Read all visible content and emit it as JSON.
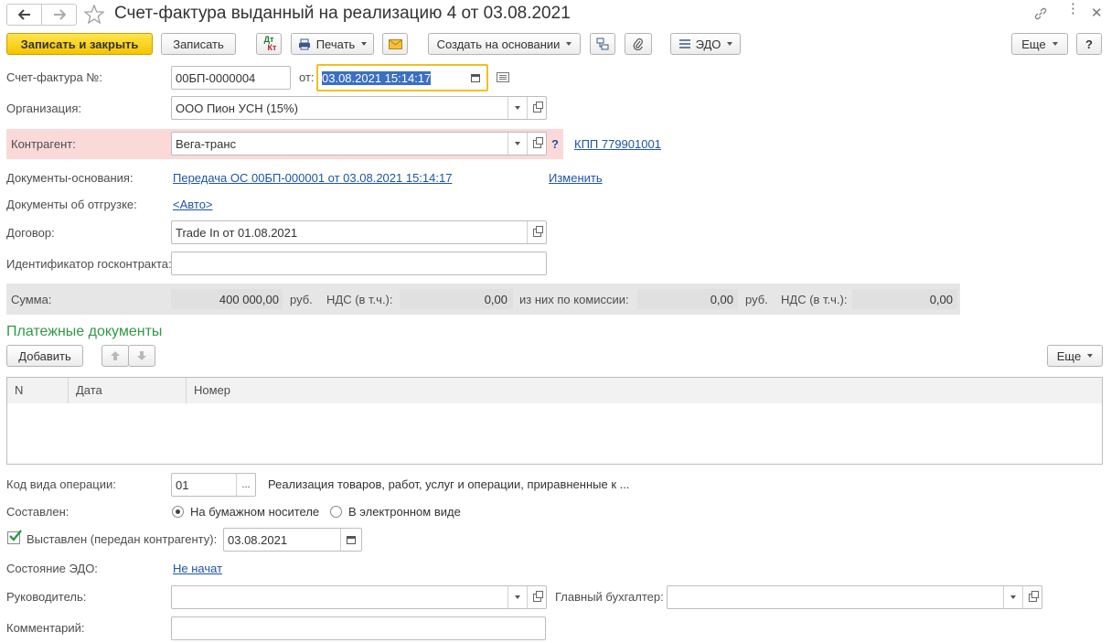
{
  "title": "Счет-фактура выданный на реализацию 4 от 03.08.2021",
  "toolbar": {
    "save_close": "Записать и закрыть",
    "save": "Записать",
    "dtkt_top": "Дт",
    "dtkt_bottom": "Кт",
    "print": "Печать",
    "create_based": "Создать на основании",
    "edo": "ЭДО",
    "more": "Еще",
    "help": "?"
  },
  "form": {
    "invoice_label": "Счет-фактура №:",
    "invoice_number": "00БП-0000004",
    "from_label": "от:",
    "date": "03.08.2021 15:14:17",
    "org_label": "Организация:",
    "org_value": "ООО Пион УСН (15%)",
    "contractor_label": "Контрагент:",
    "contractor_value": "Вега-транс",
    "contractor_q": "?",
    "kpp_link": "КПП 779901001",
    "base_docs_label": "Документы-основания:",
    "base_docs_link": "Передача ОС 00БП-000001 от 03.08.2021 15:14:17",
    "change_link": "Изменить",
    "ship_docs_label": "Документы об отгрузке:",
    "ship_docs_link": "<Авто>",
    "contract_label": "Договор:",
    "contract_value": "Trade In от 01.08.2021",
    "gov_id_label": "Идентификатор госконтракта:",
    "gov_id_value": ""
  },
  "sum": {
    "label": "Сумма:",
    "amount": "400 000,00",
    "cur1": "руб.",
    "vat_label": "НДС (в т.ч.):",
    "vat_amount": "0,00",
    "commission_label": "из них по комиссии:",
    "commission_amount": "0,00",
    "cur2": "руб.",
    "vat_label2": "НДС (в т.ч.):",
    "vat_amount2": "0,00"
  },
  "payments": {
    "title": "Платежные документы",
    "add": "Добавить",
    "more": "Еще",
    "columns": [
      "N",
      "Дата",
      "Номер"
    ]
  },
  "bottom": {
    "op_code_label": "Код вида операции:",
    "op_code": "01",
    "op_code_btn": "...",
    "op_code_desc": "Реализация товаров, работ, услуг и операции, приравненные к ...",
    "composed_label": "Составлен:",
    "paper": "На бумажном носителе",
    "electronic": "В электронном виде",
    "issued_label": "Выставлен (передан контрагенту):",
    "issued_date": "03.08.2021",
    "edo_state_label": "Состояние ЭДО:",
    "edo_state_link": "Не начат",
    "head_label": "Руководитель:",
    "head_value": "",
    "chief_acc_label": "Главный бухгалтер:",
    "chief_acc_value": "",
    "comment_label": "Комментарий:",
    "comment_value": ""
  },
  "colors": {
    "primary_button": "#f5c400",
    "contractor_highlight": "#fbd9d9",
    "link": "#1c55a8",
    "section_title": "#2f9a45",
    "date_focus_border": "#f0c020",
    "date_selection": "#3a6fc4"
  }
}
